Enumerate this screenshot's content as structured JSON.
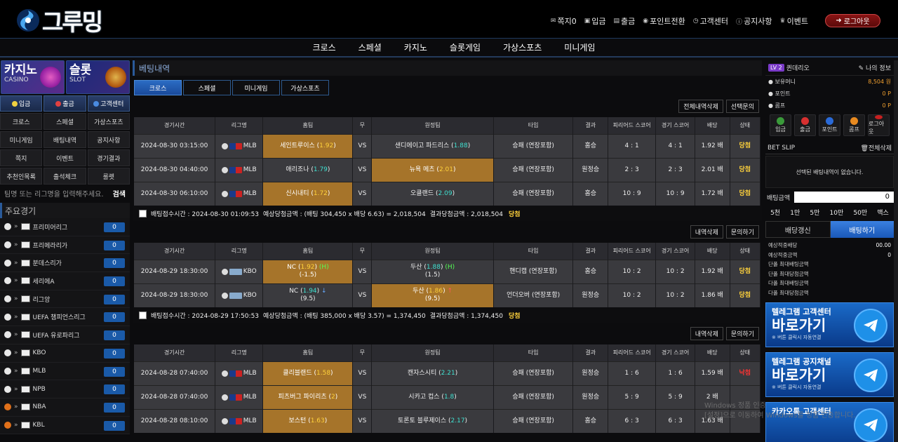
{
  "brand": {
    "logo_text": "그루밍"
  },
  "topnav": [
    {
      "icon": "mail-icon",
      "glyph": "✉",
      "label": "쪽지0"
    },
    {
      "icon": "deposit-icon",
      "glyph": "▣",
      "label": "입금"
    },
    {
      "icon": "withdraw-icon",
      "glyph": "▤",
      "label": "출금"
    },
    {
      "icon": "point-icon",
      "glyph": "◉",
      "label": "포인트전환"
    },
    {
      "icon": "support-icon",
      "glyph": "◷",
      "label": "고객센터"
    },
    {
      "icon": "notice-icon",
      "glyph": "ⓘ",
      "label": "공지사항"
    },
    {
      "icon": "event-icon",
      "glyph": "♛",
      "label": "이벤트"
    }
  ],
  "logout_label": "로그아웃",
  "mainnav": [
    "크로스",
    "스페셜",
    "카지노",
    "슬롯게임",
    "가상스포츠",
    "미니게임"
  ],
  "left": {
    "banners": [
      {
        "kr": "카지노",
        "en": "CASINO"
      },
      {
        "kr": "슬롯",
        "en": "SLOT"
      }
    ],
    "quick": [
      {
        "label": "입금",
        "color": "#f0d040"
      },
      {
        "label": "출금",
        "color": "#e04040"
      },
      {
        "label": "고객센터",
        "color": "#4a8ae0"
      }
    ],
    "menu": [
      "크로스",
      "스페셜",
      "가상스포츠",
      "미니게임",
      "배팅내역",
      "공지사항",
      "쪽지",
      "이벤트",
      "경기결과",
      "추천인목록",
      "출석체크",
      "룰렛"
    ],
    "search_placeholder": "팀명 또는 리그명을 입력해주세요.",
    "search_button": "검색",
    "section_title": "주요경기",
    "leagues": [
      {
        "name": "프리미어리그",
        "count": "0"
      },
      {
        "name": "프리메라리가",
        "count": "0"
      },
      {
        "name": "분데스리가",
        "count": "0"
      },
      {
        "name": "세리에A",
        "count": "0"
      },
      {
        "name": "리그앙",
        "count": "0"
      },
      {
        "name": "UEFA 챔피언스리그",
        "count": "0"
      },
      {
        "name": "UEFA 유로파리그",
        "count": "0"
      },
      {
        "name": "KBO",
        "count": "0"
      },
      {
        "name": "MLB",
        "count": "0"
      },
      {
        "name": "NPB",
        "count": "0"
      },
      {
        "name": "NBA",
        "count": "0"
      },
      {
        "name": "KBL",
        "count": "0"
      }
    ]
  },
  "center": {
    "title": "베팅내역",
    "tabs": [
      "크로스",
      "스페셜",
      "미니게임",
      "가상스포츠"
    ],
    "top_actions": [
      "전체내역삭제",
      "선택문의"
    ],
    "row_actions": [
      "내역삭제",
      "문의하기"
    ],
    "headers": [
      "경기시간",
      "리그명",
      "홈팀",
      "무",
      "원정팀",
      "타입",
      "결과",
      "피리어드 스코어",
      "경기 스코어",
      "배당",
      "상태"
    ],
    "groups": [
      {
        "rows": [
          {
            "time": "2024-08-30 03:15:00",
            "league": "MLB",
            "home": "세인트루이스",
            "home_odd": "1.92",
            "vs": "VS",
            "away": "샌디에이고 파드리스",
            "away_odd": "1.88",
            "sel": "home",
            "type": "승패 (연장포함)",
            "result": "홈승",
            "period": "4 : 1",
            "score": "4 : 1",
            "odds": "1.92 배",
            "status": "당첨"
          },
          {
            "time": "2024-08-30 04:40:00",
            "league": "MLB",
            "home": "애리조나",
            "home_odd": "1.79",
            "vs": "VS",
            "away": "뉴욕 메츠",
            "away_odd": "2.01",
            "sel": "away",
            "type": "승패 (연장포함)",
            "result": "원정승",
            "period": "2 : 3",
            "score": "2 : 3",
            "odds": "2.01 배",
            "status": "당첨"
          },
          {
            "time": "2024-08-30 06:10:00",
            "league": "MLB",
            "home": "신시내티",
            "home_odd": "1.72",
            "vs": "VS",
            "away": "오클랜드",
            "away_odd": "2.09",
            "sel": "home",
            "type": "승패 (연장포함)",
            "result": "홈승",
            "period": "10 : 9",
            "score": "10 : 9",
            "odds": "1.72 배",
            "status": "당첨"
          }
        ],
        "slip": {
          "time": "배팅접수시간 : 2024-08-30 01:09:53",
          "expected": "예상당첨금액 : (배팅 304,450 x 배당 6.63) = 2,018,504",
          "result": "결과당첨금액 : 2,018,504",
          "status": "당첨"
        }
      },
      {
        "rows": [
          {
            "time": "2024-08-29 18:30:00",
            "league": "KBO",
            "home": "NC",
            "home_odd": "1.92",
            "home_extra": "(H)",
            "home_line": "(-1.5)",
            "vs": "VS",
            "away": "두산",
            "away_odd": "1.88",
            "away_extra": "(H)",
            "away_line": "(1.5)",
            "sel": "home",
            "type": "핸디캡 (연장포함)",
            "result": "홈승",
            "period": "10 : 2",
            "score": "10 : 2",
            "odds": "1.92 배",
            "status": "당첨"
          },
          {
            "time": "2024-08-29 18:30:00",
            "league": "KBO",
            "home": "NC",
            "home_odd": "1.94",
            "home_extra": "↓",
            "home_line": "(9.5)",
            "vs": "VS",
            "away": "두산",
            "away_odd": "1.86",
            "away_extra": "↑",
            "away_line": "(9.5)",
            "sel": "away",
            "type": "언더오버 (연장포함)",
            "result": "원정승",
            "period": "10 : 2",
            "score": "10 : 2",
            "odds": "1.86 배",
            "status": "당첨"
          }
        ],
        "slip": {
          "time": "배팅접수시간 : 2024-08-29 17:50:53",
          "expected": "예상당첨금액 : (배팅 385,000 x 배당 3.57) = 1,374,450",
          "result": "결과당첨금액 : 1,374,450",
          "status": "당첨"
        }
      },
      {
        "rows": [
          {
            "time": "2024-08-28 07:40:00",
            "league": "MLB",
            "home": "클리블랜드",
            "home_odd": "1.58",
            "vs": "VS",
            "away": "캔자스시티",
            "away_odd": "2.21",
            "sel": "home",
            "type": "승패 (연장포함)",
            "result": "원정승",
            "period": "1 : 6",
            "score": "1 : 6",
            "odds": "1.59 배",
            "status": "낙첨"
          },
          {
            "time": "2024-08-28 07:40:00",
            "league": "MLB",
            "home": "피츠버그 파이리츠",
            "home_odd": "2",
            "vs": "VS",
            "away": "시카고 컵스",
            "away_odd": "1.8",
            "sel": "home",
            "type": "승패 (연장포함)",
            "result": "원정승",
            "period": "5 : 9",
            "score": "5 : 9",
            "odds": "2 배",
            "status": ""
          },
          {
            "time": "2024-08-28 08:10:00",
            "league": "MLB",
            "home": "보스턴",
            "home_odd": "1.63",
            "vs": "VS",
            "away": "토론토 블루제이스",
            "away_odd": "2.17",
            "sel": "home",
            "type": "승패 (연장포함)",
            "result": "홈승",
            "period": "6 : 3",
            "score": "6 : 3",
            "odds": "1.63 배",
            "status": ""
          }
        ]
      }
    ]
  },
  "right": {
    "level": "LV 2",
    "username": "퀸데리오",
    "myinfo": "나의 정보",
    "info": [
      {
        "label": "보유머니",
        "value": "8,504 원"
      },
      {
        "label": "포인트",
        "value": "0 P"
      },
      {
        "label": "콤프",
        "value": "0 P"
      }
    ],
    "icons": [
      {
        "label": "입금",
        "color": "#3a9a3a"
      },
      {
        "label": "출금",
        "color": "#d83030"
      },
      {
        "label": "포인트",
        "color": "#2a6ad8"
      },
      {
        "label": "콤프",
        "color": "#e88a20"
      },
      {
        "label": "로그아웃",
        "color": "#c82020"
      }
    ],
    "betslip_title": "BET SLIP",
    "betslip_clear": "전체삭제",
    "empty": "선택된 배팅내역이 없습니다.",
    "amount_label": "배팅금액",
    "amount": "0",
    "quick": [
      "5천",
      "1만",
      "5만",
      "10만",
      "50만",
      "맥스"
    ],
    "btn_refresh": "배당갱신",
    "btn_bet": "배팅하기",
    "summary": [
      {
        "label": "예상적중배당",
        "value": "00.00"
      },
      {
        "label": "예상적중금액",
        "value": "0"
      },
      {
        "label": "단폴 최대배팅금액",
        "value": ""
      },
      {
        "label": "단폴 최대당첨금액",
        "value": ""
      },
      {
        "label": "다폴 최대배팅금액",
        "value": ""
      },
      {
        "label": "다폴 최대당첨금액",
        "value": ""
      }
    ],
    "promos": [
      {
        "t1": "텔레그램 고객센터",
        "t2": "바로가기",
        "t3": "※ 버튼 클릭시 자동연결"
      },
      {
        "t1": "텔레그램 공지채널",
        "t2": "바로가기",
        "t3": "※ 버튼 클릭시 자동연결"
      },
      {
        "t1": "카카오톡 고객센터",
        "t2": "",
        "t3": ""
      }
    ]
  },
  "watermark": [
    "Windows 정품 인증",
    "[설정]으로 이동하여 Windows를 정품 인증합니다."
  ]
}
